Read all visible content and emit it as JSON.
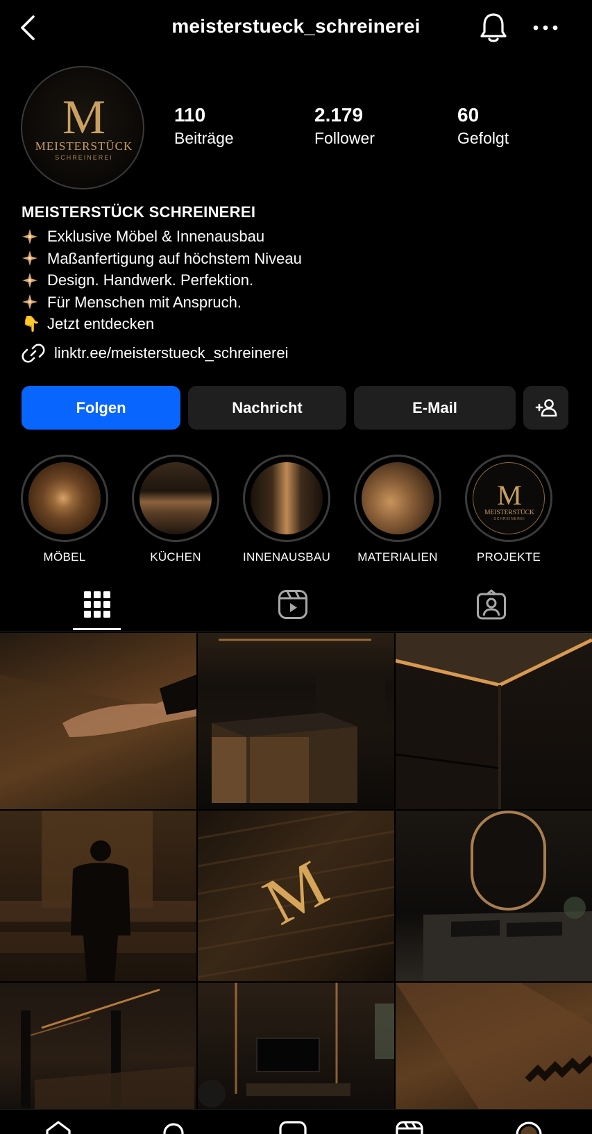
{
  "header": {
    "username": "meisterstueck_schreinerei"
  },
  "avatar": {
    "monogram": "M",
    "brand": "MEISTERSTÜCK",
    "sub": "SCHREINEREI"
  },
  "stats": [
    {
      "value": "110",
      "label": "Beiträge"
    },
    {
      "value": "2.179",
      "label": "Follower"
    },
    {
      "value": "60",
      "label": "Gefolgt"
    }
  ],
  "bio": {
    "name": "MEISTERSTÜCK SCHREINEREI",
    "lines": [
      "Exklusive Möbel & Innenausbau",
      "Maßanfertigung auf höchstem Niveau",
      "Design. Handwerk. Perfektion.",
      "Für Menschen mit Anspruch."
    ],
    "cta": "Jetzt entdecken",
    "cta_emoji": "👇",
    "link": "linktr.ee/meisterstueck_schreinerei"
  },
  "actions": {
    "follow": "Folgen",
    "message": "Nachricht",
    "email": "E-Mail"
  },
  "highlights": [
    {
      "label": "MÖBEL"
    },
    {
      "label": "KÜCHEN"
    },
    {
      "label": "INNENAUSBAU"
    },
    {
      "label": "MATERIALIEN"
    },
    {
      "label": "PROJEKTE"
    }
  ],
  "highlight_logo": {
    "monogram": "M",
    "brand": "MEISTERSTÜCK",
    "sub": "SCHREINEREI"
  },
  "tabs": [
    "grid",
    "reels",
    "tagged"
  ],
  "posts_monogram": "M",
  "colors": {
    "accent": "#0866ff",
    "gold": "#c9a061",
    "background": "#000000",
    "button": "#1f1f1f"
  }
}
